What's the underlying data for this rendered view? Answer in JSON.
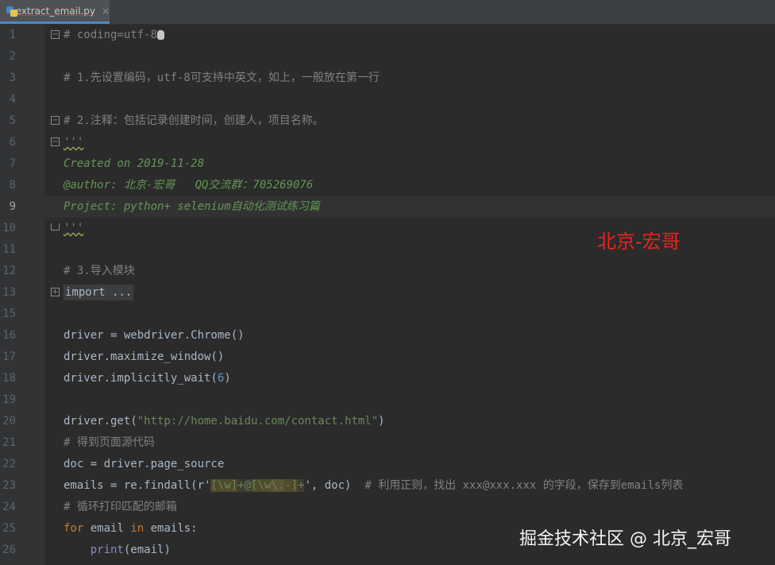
{
  "tab": {
    "filename": "extract_email.py",
    "close": "×"
  },
  "lines": {
    "n1": "1",
    "n2": "2",
    "n3": "3",
    "n4": "4",
    "n5": "5",
    "n6": "6",
    "n7": "7",
    "n8": "8",
    "n9": "9",
    "n10": "10",
    "n11": "11",
    "n12": "12",
    "n13": "13",
    "n15": "15",
    "n16": "16",
    "n17": "17",
    "n18": "18",
    "n19": "19",
    "n20": "20",
    "n21": "21",
    "n22": "22",
    "n23": "23",
    "n24": "24",
    "n25": "25",
    "n26": "26"
  },
  "code": {
    "l1": "# coding=utf-8",
    "l3": "# 1.先设置编码，utf-8可支持中英文，如上，一般放在第一行",
    "l5": "# 2.注释：包括记录创建时间，创建人，项目名称。",
    "l6": "'''",
    "l7": "Created on 2019-11-28",
    "l8": "@author: 北京-宏哥   QQ交流群：705269076",
    "l9": "Project: python+ selenium自动化测试练习篇",
    "l10": "'''",
    "l12": "# 3.导入模块",
    "l13": "import ...",
    "l16a": "driver = webdriver.Chrome()",
    "l17": "driver.maximize_window()",
    "l18a": "driver.implicitly_wait(",
    "l18n": "6",
    "l18b": ")",
    "l20a": "driver.get(",
    "l20s": "\"http://home.baidu.com/contact.html\"",
    "l20b": ")",
    "l21": "# 得到页面源代码",
    "l22": "doc = driver.page_source",
    "l23a": "emails = re.findall(r'",
    "l23r1": "[\\w]",
    "l23r2": "+@",
    "l23r3": "[\\w",
    "l23r4": "\\.",
    "l23r5": "-]",
    "l23r6": "+",
    "l23b": "', doc)",
    "l23c": "  # 利用正则，找出 xxx@xxx.xxx 的字段，保存到emails列表",
    "l24": "# 循环打印匹配的邮箱",
    "l25kw1": "for",
    "l25a": " email ",
    "l25kw2": "in",
    "l25b": " emails:",
    "l26ind": "    ",
    "l26fn": "print",
    "l26b": "(email)"
  },
  "overlay": {
    "author_label": "北京-宏哥"
  },
  "watermark": {
    "text": "掘金技术社区 @ 北京_宏哥"
  },
  "colors": {
    "comment": "#808080",
    "docstring": "#629755",
    "string": "#6a8759",
    "keyword": "#cc7832",
    "number": "#6897bb",
    "overlay_red": "#e8251c"
  }
}
